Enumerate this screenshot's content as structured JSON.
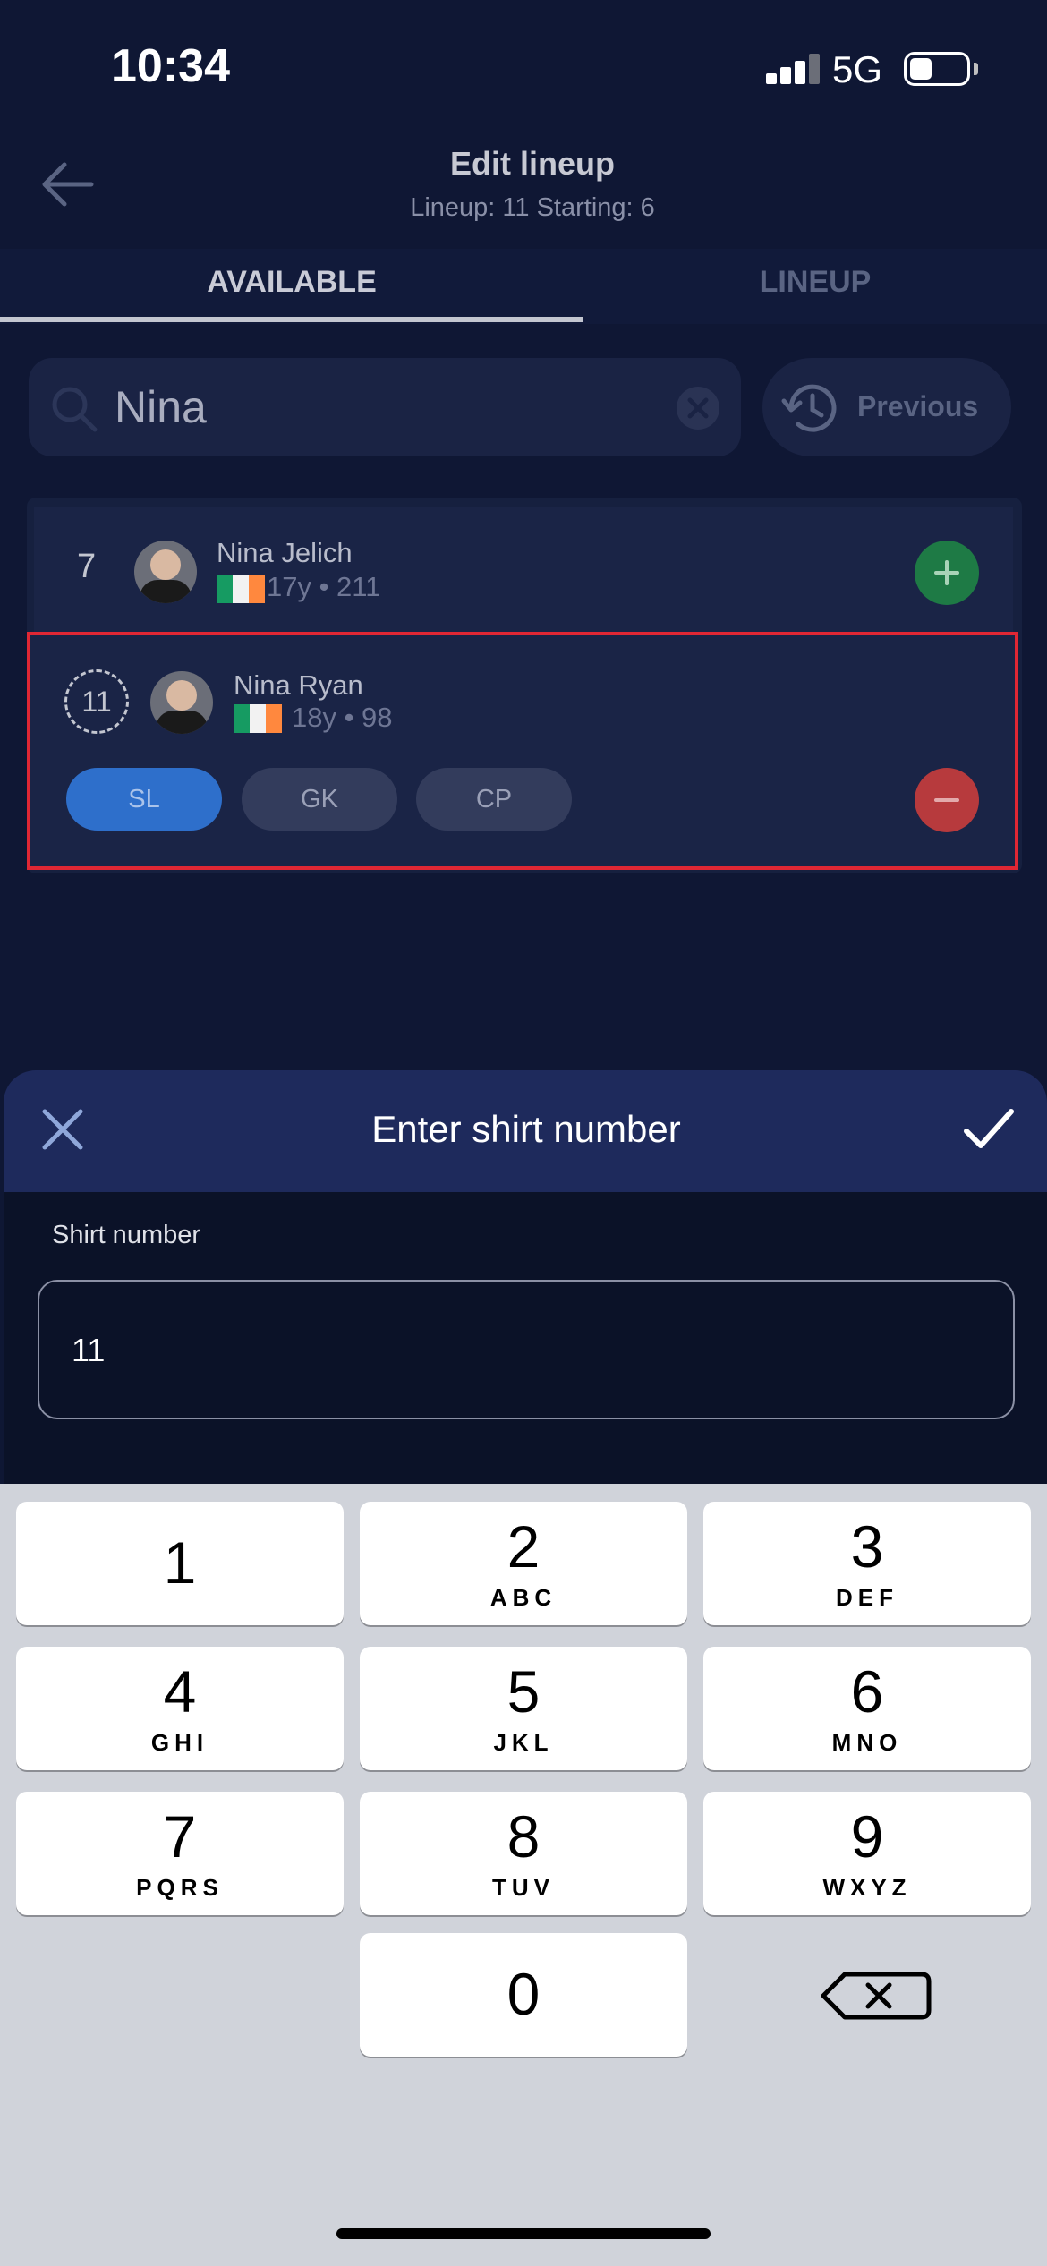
{
  "status_bar": {
    "time": "10:34",
    "network": "5G"
  },
  "header": {
    "title": "Edit lineup",
    "subtitle": "Lineup: 11 Starting: 6"
  },
  "tabs": [
    {
      "label": "AVAILABLE"
    },
    {
      "label": "LINEUP"
    }
  ],
  "search": {
    "value": "Nina",
    "previous_label": "Previous"
  },
  "players": [
    {
      "number": "7",
      "name": "Nina Jelich",
      "meta": "17y • 211"
    },
    {
      "number": "11",
      "name": "Nina Ryan",
      "meta": "18y • 98",
      "positions": [
        "SL",
        "GK",
        "CP"
      ]
    }
  ],
  "sheet": {
    "title": "Enter shirt number",
    "field_label": "Shirt number",
    "field_value": "11"
  },
  "keypad": [
    {
      "digit": "1",
      "letters": ""
    },
    {
      "digit": "2",
      "letters": "ABC"
    },
    {
      "digit": "3",
      "letters": "DEF"
    },
    {
      "digit": "4",
      "letters": "GHI"
    },
    {
      "digit": "5",
      "letters": "JKL"
    },
    {
      "digit": "6",
      "letters": "MNO"
    },
    {
      "digit": "7",
      "letters": "PQRS"
    },
    {
      "digit": "8",
      "letters": "TUV"
    },
    {
      "digit": "9",
      "letters": "WXYZ"
    },
    {
      "digit": "0",
      "letters": ""
    }
  ],
  "colors": {
    "background": "#0f1734",
    "add": "#1e7a45",
    "remove": "#b73a3d",
    "chip_selected": "#2e6fcb",
    "highlight_border": "#e02734"
  }
}
